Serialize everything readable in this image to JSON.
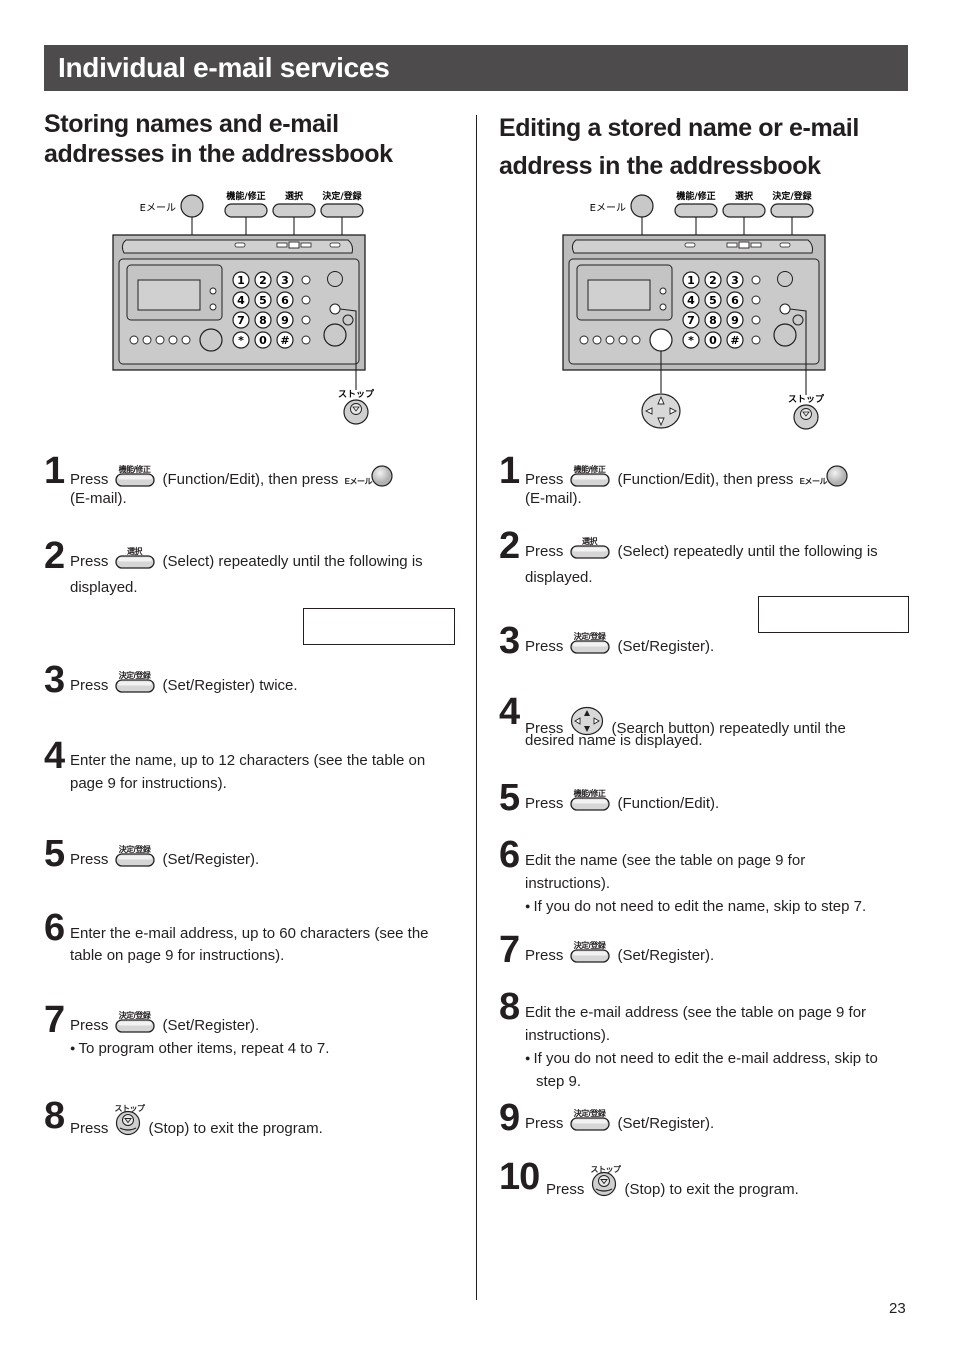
{
  "header": {
    "title": "Individual e-mail services"
  },
  "left_section": {
    "title": "Storing names and e-mail addresses in the addressbook",
    "device_labels": {
      "email": "Eメール",
      "function_edit": "機能/修正",
      "select": "選択",
      "set_register": "決定/登録",
      "stop": "ストップ"
    },
    "display_box_text": "",
    "steps": [
      {
        "number": "1",
        "press": "Press",
        "button": "機能/修正",
        "text": "(Function/Edit), then press",
        "button2": "Eメール",
        "text2": "(E-mail)."
      },
      {
        "number": "2",
        "press": "Press",
        "button": "選択",
        "text": "(Select) repeatedly until the following is",
        "text2": "displayed."
      },
      {
        "number": "3",
        "press": "Press",
        "button": "決定/登録",
        "text": "(Set/Register) twice."
      },
      {
        "number": "4",
        "text": "Enter the name, up to 12 characters (see the table on",
        "text2": "page 9 for instructions)."
      },
      {
        "number": "5",
        "press": "Press",
        "button": "決定/登録",
        "text": "(Set/Register)."
      },
      {
        "number": "6",
        "text": "Enter the e-mail address, up to 60 characters (see the",
        "text2": "table on page 9 for instructions)."
      },
      {
        "number": "7",
        "press": "Press",
        "button": "決定/登録",
        "text": "(Set/Register).",
        "bullet": "To program other items, repeat 4 to 7."
      },
      {
        "number": "8",
        "press": "Press",
        "button": "ストップ",
        "text": "(Stop) to exit the program."
      }
    ]
  },
  "right_section": {
    "title_line1": "Editing a stored name or e-mail",
    "title_line2": "address in the addressbook",
    "device_labels": {
      "email": "Eメール",
      "function_edit": "機能/修正",
      "select": "選択",
      "set_register": "決定/登録",
      "stop": "ストップ"
    },
    "display_box_text": "",
    "steps": [
      {
        "number": "1",
        "press": "Press",
        "button": "機能/修正",
        "text": "(Function/Edit), then press",
        "button2": "Eメール",
        "text2": "(E-mail)."
      },
      {
        "number": "2",
        "press": "Press",
        "button": "選択",
        "text": "(Select) repeatedly until the following is",
        "text2": "displayed."
      },
      {
        "number": "3",
        "press": "Press",
        "button": "決定/登録",
        "text": "(Set/Register)."
      },
      {
        "number": "4",
        "press": "Press",
        "text": "(Search button) repeatedly until the",
        "text2": "desired name is displayed."
      },
      {
        "number": "5",
        "press": "Press",
        "button": "機能/修正",
        "text": "(Function/Edit)."
      },
      {
        "number": "6",
        "text": "Edit the name (see the table on page 9 for",
        "text2": "instructions).",
        "bullet": "If you do not need to edit the name, skip to step 7."
      },
      {
        "number": "7",
        "press": "Press",
        "button": "決定/登録",
        "text": "(Set/Register)."
      },
      {
        "number": "8",
        "text": "Edit the e-mail address (see the table on page 9 for",
        "text2": "instructions).",
        "bullet": "If you do not need to edit the e-mail address, skip to",
        "bullet2": "step 9."
      },
      {
        "number": "9",
        "press": "Press",
        "button": "決定/登録",
        "text": "(Set/Register)."
      },
      {
        "number": "10",
        "press": "Press",
        "button": "ストップ",
        "text": "(Stop) to exit the program."
      }
    ]
  },
  "keypad": [
    "1",
    "2",
    "3",
    "4",
    "5",
    "6",
    "7",
    "8",
    "9",
    "*",
    "0",
    "#"
  ],
  "bullet_glyph": "●",
  "page_number": "23"
}
